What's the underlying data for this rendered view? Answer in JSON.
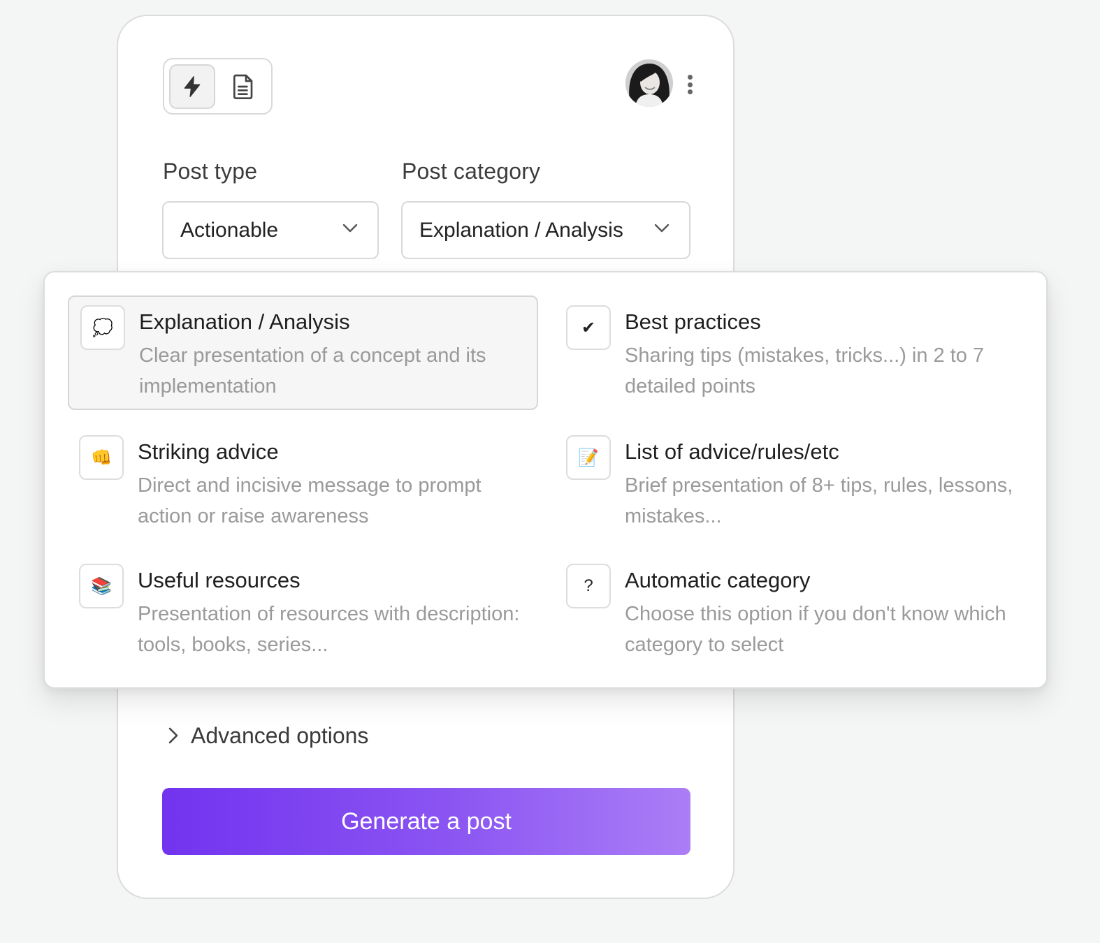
{
  "form": {
    "post_type_label": "Post type",
    "post_type_value": "Actionable",
    "post_category_label": "Post category",
    "post_category_value": "Explanation / Analysis",
    "advanced_label": "Advanced options",
    "generate_label": "Generate a post"
  },
  "toolbar": {
    "modes": [
      {
        "icon": "lightning-icon",
        "active": true
      },
      {
        "icon": "document-icon",
        "active": false
      }
    ],
    "avatar_icon": "user-avatar",
    "menu_icon": "kebab-menu-icon"
  },
  "category_options": [
    {
      "title": "Explanation / Analysis",
      "description": "Clear presentation of a concept and its implementation",
      "icon": "thought-bubble-icon",
      "glyph": "💭",
      "selected": true
    },
    {
      "title": "Best practices",
      "description": "Sharing tips (mistakes, tricks...) in 2 to 7 detailed points",
      "icon": "check-icon",
      "glyph": "✔",
      "selected": false
    },
    {
      "title": "Striking advice",
      "description": "Direct and incisive message to prompt action or raise awareness",
      "icon": "fist-icon",
      "glyph": "👊",
      "selected": false
    },
    {
      "title": "List of advice/rules/etc",
      "description": "Brief presentation of 8+ tips, rules, lessons, mistakes...",
      "icon": "memo-icon",
      "glyph": "📝",
      "selected": false
    },
    {
      "title": "Useful resources",
      "description": "Presentation of resources with description: tools, books, series...",
      "icon": "books-icon",
      "glyph": "📚",
      "selected": false
    },
    {
      "title": "Automatic category",
      "description": "Choose this option if you don't know which category to select",
      "icon": "question-icon",
      "glyph": "?",
      "selected": false
    }
  ],
  "colors": {
    "accent_start": "#7233ef",
    "accent_end": "#ab7ef6"
  }
}
